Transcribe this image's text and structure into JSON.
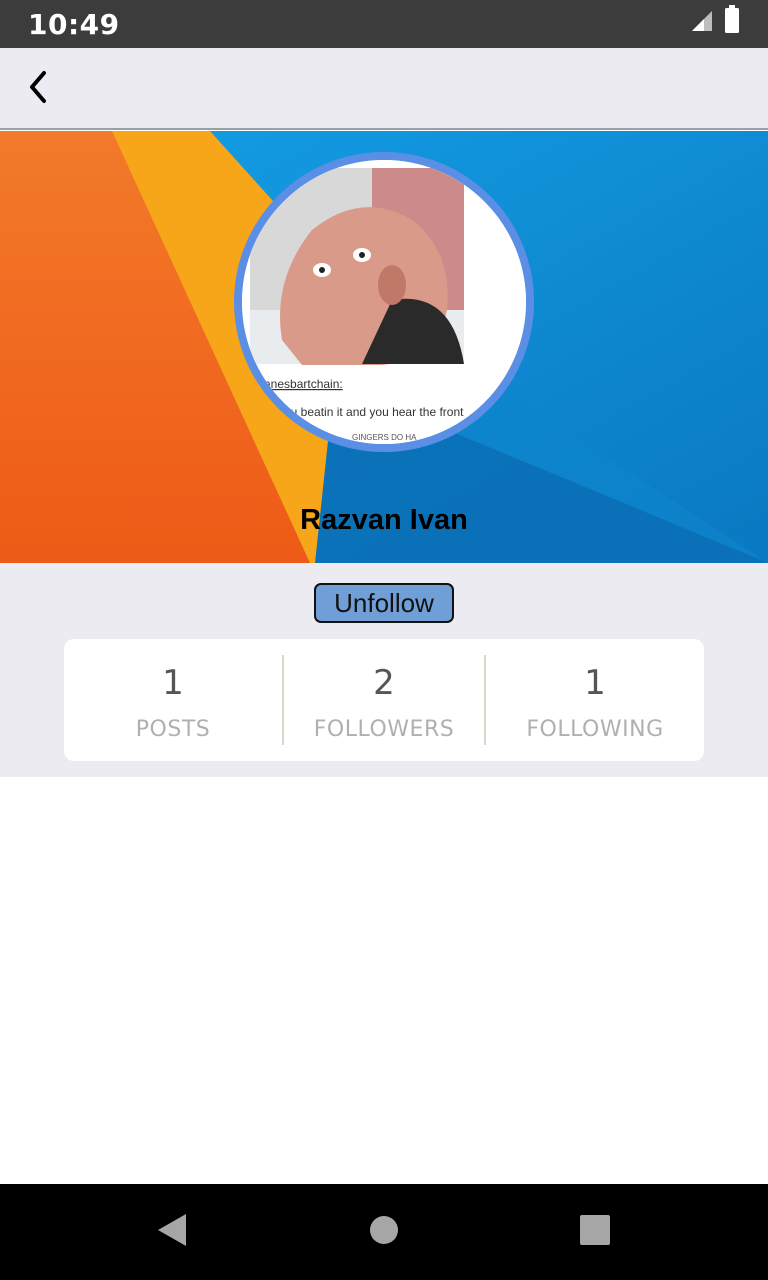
{
  "status_bar": {
    "time": "10:49",
    "icons": [
      "signal-icon",
      "battery-icon"
    ]
  },
  "app_bar": {
    "back_icon": "back-arrow-icon"
  },
  "profile": {
    "name": "Razvan Ivan",
    "avatar_caption_user": "anesbartchain:",
    "avatar_caption_text": "ou beatin it and you hear the front",
    "avatar_caption_small": "GINGERS DO HA"
  },
  "follow": {
    "label": "Unfollow"
  },
  "stats": [
    {
      "value": "1",
      "label": "POSTS"
    },
    {
      "value": "2",
      "label": "FOLLOWERS"
    },
    {
      "value": "1",
      "label": "FOLLOWING"
    }
  ],
  "colors": {
    "status_bar": "#3c3c3c",
    "app_bar": "#ecebf2",
    "avatar_ring": "#5b8fe6",
    "follow_button": "#6f9fd6",
    "cover_blue": "#1290d6",
    "cover_orange": "#f26a1f",
    "cover_yellow": "#f7a519"
  },
  "nav_bar": {
    "icons": [
      "back-triangle-icon",
      "home-circle-icon",
      "recents-square-icon"
    ]
  }
}
